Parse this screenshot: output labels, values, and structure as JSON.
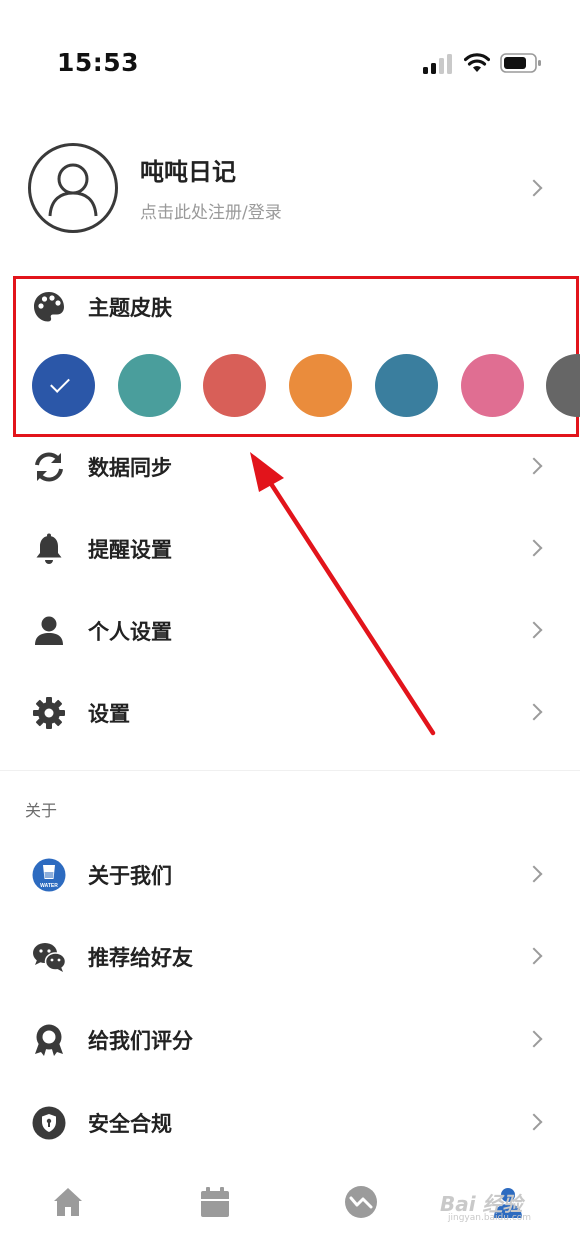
{
  "status_bar": {
    "time": "15:53"
  },
  "profile": {
    "name": "吨吨日记",
    "subtitle": "点击此处注册/登录"
  },
  "theme": {
    "title": "主题皮肤",
    "swatches": [
      {
        "color": "#2b57a8",
        "selected": true
      },
      {
        "color": "#4a9e9c",
        "selected": false
      },
      {
        "color": "#d85f58",
        "selected": false
      },
      {
        "color": "#ea8c3c",
        "selected": false
      },
      {
        "color": "#3a7e9e",
        "selected": false
      },
      {
        "color": "#e06e92",
        "selected": false
      },
      {
        "color": "#666666",
        "selected": false
      }
    ]
  },
  "menu": [
    {
      "label": "数据同步",
      "icon": "sync-icon"
    },
    {
      "label": "提醒设置",
      "icon": "bell-icon"
    },
    {
      "label": "个人设置",
      "icon": "person-icon"
    },
    {
      "label": "设置",
      "icon": "gear-icon"
    }
  ],
  "about_section": {
    "header": "关于",
    "items": [
      {
        "label": "关于我们",
        "icon": "water-logo-icon",
        "icon_text": "WATER"
      },
      {
        "label": "推荐给好友",
        "icon": "wechat-icon"
      },
      {
        "label": "给我们评分",
        "icon": "award-icon"
      },
      {
        "label": "安全合规",
        "icon": "shield-icon"
      }
    ]
  },
  "tabbar": {
    "tabs": [
      "home-icon",
      "calendar-icon",
      "chart-icon",
      "profile-icon"
    ]
  },
  "watermark": {
    "text": "Bai 经验",
    "sub": "jingyan.baidu.com"
  },
  "colors": {
    "accent_red": "#e2141b",
    "icon_gray": "#3a3a3a",
    "chevron": "#9b9b9b"
  }
}
